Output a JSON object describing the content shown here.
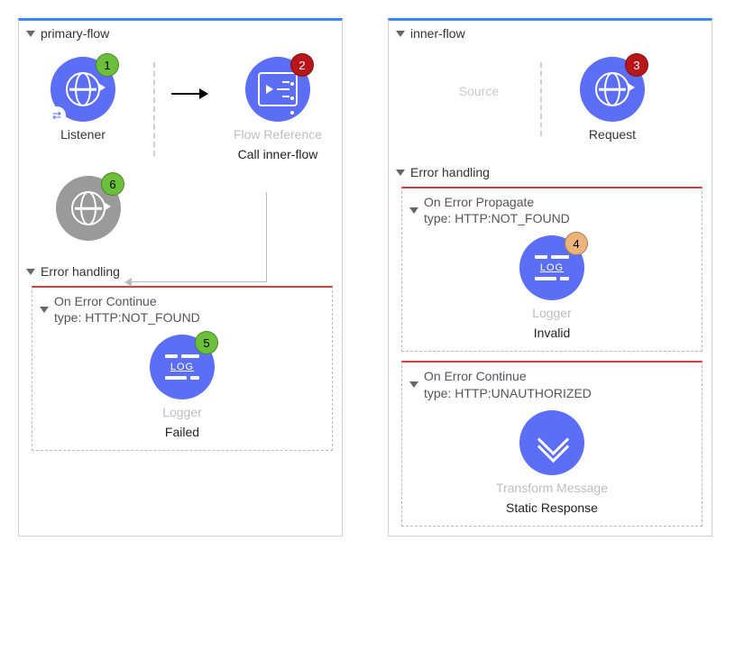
{
  "left_flow": {
    "title": "primary-flow",
    "listener": {
      "type": "Listener",
      "name": "",
      "badge": "1"
    },
    "flowref": {
      "type": "Flow Reference",
      "name": "Call inner-flow",
      "badge": "2"
    },
    "listener_return": {
      "type": "",
      "name": "",
      "badge": "6"
    },
    "error_section_title": "Error handling",
    "handler1": {
      "kind": "On Error Continue",
      "type_line": "type: HTTP:NOT_FOUND",
      "node": {
        "type": "Logger",
        "name": "Failed",
        "badge": "5"
      }
    }
  },
  "right_flow": {
    "title": "inner-flow",
    "source_placeholder": "Source",
    "request": {
      "type": "Request",
      "name": "",
      "badge": "3"
    },
    "error_section_title": "Error handling",
    "handler1": {
      "kind": "On Error Propagate",
      "type_line": "type: HTTP:NOT_FOUND",
      "node": {
        "type": "Logger",
        "name": "Invalid",
        "badge": "4"
      }
    },
    "handler2": {
      "kind": "On Error Continue",
      "type_line": "type: HTTP:UNAUTHORIZED",
      "node": {
        "type": "Transform Message",
        "name": "Static Response"
      }
    }
  }
}
